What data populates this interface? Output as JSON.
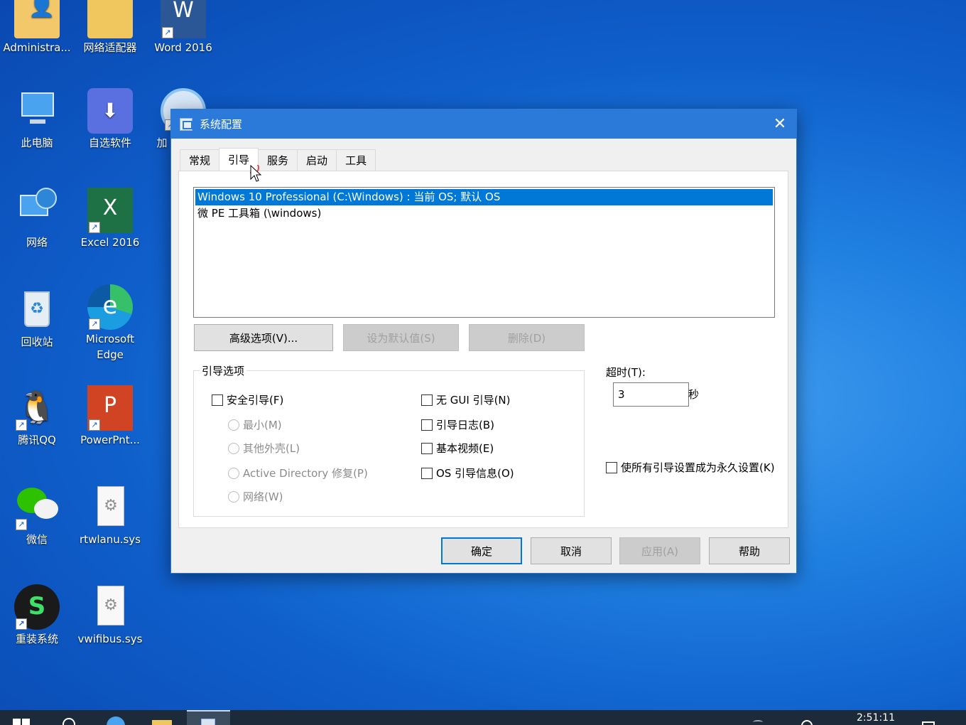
{
  "desktop": {
    "icons": [
      {
        "label": "Administra...",
        "glyph": "👤"
      },
      {
        "label": "网络适配器",
        "glyph": "📁"
      },
      {
        "label": "Word 2016",
        "glyph": "W"
      },
      {
        "label": "此电脑",
        "glyph": "🖥"
      },
      {
        "label": "自选软件",
        "glyph": "⬇"
      },
      {
        "label": "加",
        "glyph": "⊙"
      },
      {
        "label": "网络",
        "glyph": "🌐"
      },
      {
        "label": "Excel 2016",
        "glyph": "X"
      },
      {
        "label": "回收站",
        "glyph": "♻"
      },
      {
        "label": "Microsoft Edge",
        "glyph": "e"
      },
      {
        "label": "腾讯QQ",
        "glyph": "🐧"
      },
      {
        "label": "PowerPnt...",
        "glyph": "P"
      },
      {
        "label": "微信",
        "glyph": "💬"
      },
      {
        "label": "rtwlanu.sys",
        "glyph": "⚙"
      },
      {
        "label": "重装系统",
        "glyph": "S"
      },
      {
        "label": "vwifibus.sys",
        "glyph": "⚙"
      }
    ],
    "shortcut_glyph": "↗"
  },
  "dialog": {
    "title": "系统配置",
    "close_glyph": "✕",
    "tabs": [
      "常规",
      "引导",
      "服务",
      "启动",
      "工具"
    ],
    "active_tab": "引导",
    "os_list": [
      "Windows 10 Professional (C:\\Windows) : 当前 OS; 默认 OS",
      "微 PE 工具箱 (\\windows)"
    ],
    "buttons": {
      "advanced": "高级选项(V)...",
      "set_default": "设为默认值(S)",
      "delete": "删除(D)"
    },
    "boot_options": {
      "legend": "引导选项",
      "safe_boot": "安全引导(F)",
      "minimal": "最小(M)",
      "alternate_shell": "其他外壳(L)",
      "ad_repair": "Active Directory 修复(P)",
      "network": "网络(W)",
      "no_gui": "无 GUI 引导(N)",
      "boot_log": "引导日志(B)",
      "base_video": "基本视频(E)",
      "os_boot_info": "OS 引导信息(O)"
    },
    "timeout": {
      "label": "超时(T):",
      "value": "3",
      "unit": "秒"
    },
    "permanent": "使所有引导设置成为永久设置(K)",
    "footer": {
      "ok": "确定",
      "cancel": "取消",
      "apply": "应用(A)",
      "help": "帮助"
    }
  },
  "taskbar": {
    "clock": "2:51:11"
  },
  "colors": {
    "titlebar": "#2b79d9",
    "selection": "#0078d7",
    "taskbar": "#1d2a3a"
  }
}
